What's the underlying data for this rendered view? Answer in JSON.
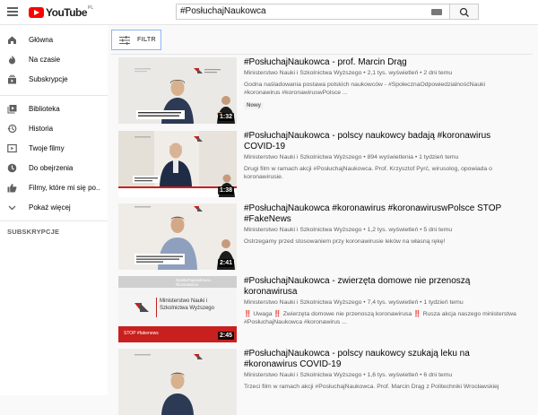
{
  "header": {
    "logo_text": "YouTube",
    "logo_region": "PL",
    "search_value": "#PosłuchajNaukowca"
  },
  "sidebar": {
    "items": [
      {
        "label": "Główna",
        "icon": "home-icon"
      },
      {
        "label": "Na czasie",
        "icon": "flame-icon"
      },
      {
        "label": "Subskrypcje",
        "icon": "subscriptions-icon"
      },
      {
        "label": "Biblioteka",
        "icon": "library-icon"
      },
      {
        "label": "Historia",
        "icon": "history-icon"
      },
      {
        "label": "Twoje filmy",
        "icon": "your-videos-icon"
      },
      {
        "label": "Do obejrzenia",
        "icon": "watch-later-icon"
      },
      {
        "label": "Filmy, które mi się po...",
        "icon": "thumbs-up-icon"
      },
      {
        "label": "Pokaż więcej",
        "icon": "chevron-down-icon"
      }
    ],
    "subscriptions_title": "SUBSKRYPCJE"
  },
  "filter": {
    "label": "FILTR"
  },
  "videos": [
    {
      "title": "#PosłuchajNaukowca - prof. Marcin Drąg",
      "channel": "Ministerstwo Nauki i Szkolnictwa Wyższego",
      "views": "2,1 tys. wyświetleń",
      "age": "2 dni temu",
      "description": "Godna naśladowania postawa polskich naukowców - #SpołecznaOdpowiedzialnośćNauki #koronawirus #koronawiruswPolsce ...",
      "badge": "Nowy",
      "duration": "1:32",
      "thumb_caption": "Lindale to polfakego i je procenzeri. Nany tepilo agoonia z nej mnee leczaniu"
    },
    {
      "title": "#PosłuchajNaukowca - polscy naukowcy badają #koronawirus COVID-19",
      "channel": "Ministerstwo Nauki i Szkolnictwa Wyższego",
      "views": "894 wyświetlenia",
      "age": "1 tydzień temu",
      "description": "Drugi film w ramach akcji #PosłuchajNaukowca. Prof. Krzysztof Pyrć, wirusolog, opowiada o koronawirusie.",
      "duration": "1:38",
      "thumb_caption": "#posłuchajnaukowca #koronawirus"
    },
    {
      "title": "#PosłuchajNaukowca #koronawirus #koronawiruswPolsce STOP #FakeNews",
      "channel": "Ministerstwo Nauki i Szkolnictwa Wyższego",
      "views": "1,2 tys. wyświetleń",
      "age": "5 dni temu",
      "description": "Ostrzegamy przed stosowaniem przy koronawirusie leków na własną rękę!",
      "duration": "2:41",
      "thumb_caption": "uważam, żeby trzeba pomyśleć się ze swoimi w zwiększu koronowirusem"
    },
    {
      "title": "#PosłuchajNaukowca - zwierzęta domowe nie przenoszą koronawirusa",
      "channel": "Ministerstwo Nauki i Szkolnictwa Wyższego",
      "views": "7,4 tys. wyświetleń",
      "age": "1 tydzień temu",
      "description_parts": [
        "‼️",
        " Uwaga ",
        "‼️",
        " Zwierzęta domowe nie przenoszą koronawirusa ",
        "‼️",
        " Rusza akcja naszego ministerstwa #PosłuchajNaukowca #koronawirus ..."
      ],
      "duration": "2:45",
      "thumb_hashtags": "#posłuchajnaukowca #koronawirus",
      "thumb_org": "Ministerstwo Nauki i Szkolnictwa Wyższego",
      "thumb_stop": "STOP #fakenews"
    },
    {
      "title": "#PosłuchajNaukowca - polscy naukowcy szukają leku na #koronawirus COVID-19",
      "channel": "Ministerstwo Nauki i Szkolnictwa Wyższego",
      "views": "1,6 tys. wyświetleń",
      "age": "6 dni temu",
      "description": "Trzeci film w ramach akcji #PosłuchajNaukowca. Prof. Marcin Drąg z Politechniki Wrocławskiej"
    }
  ],
  "colors": {
    "brand": "#ff0000",
    "filter_border": "#8ab4f8",
    "warning": "#cc0000"
  }
}
